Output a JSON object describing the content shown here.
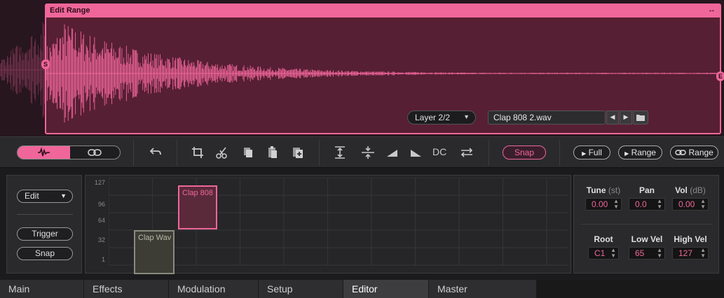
{
  "waveform": {
    "edit_range_label": "Edit Range",
    "range_arrows": "↔",
    "start_marker": "S",
    "end_marker": "E",
    "layer_select": "Layer 2/2",
    "file_name": "Clap 808 2.wav",
    "accent": "#f0669a"
  },
  "toolbar": {
    "dc_label": "DC",
    "snap_label": "Snap",
    "play_full_label": "Full",
    "play_range_label": "Range",
    "loop_range_label": "Range"
  },
  "editor": {
    "edit_select": "Edit",
    "trigger_label": "Trigger",
    "snap_label": "Snap",
    "velocity_ticks": [
      "127",
      "96",
      "64",
      "32",
      "1"
    ],
    "zones": [
      {
        "name": "Clap 808"
      },
      {
        "name": "Clap Wav"
      }
    ]
  },
  "params": {
    "tune": {
      "label": "Tune",
      "unit": "(st)",
      "value": "0.00"
    },
    "pan": {
      "label": "Pan",
      "value": "0.0"
    },
    "vol": {
      "label": "Vol",
      "unit": "(dB)",
      "value": "0.00"
    },
    "root": {
      "label": "Root",
      "value": "C1"
    },
    "low_vel": {
      "label": "Low Vel",
      "value": "65"
    },
    "high_vel": {
      "label": "High Vel",
      "value": "127"
    }
  },
  "tabs": [
    "Main",
    "Effects",
    "Modulation",
    "Setup",
    "Editor",
    "Master"
  ],
  "active_tab": "Editor"
}
